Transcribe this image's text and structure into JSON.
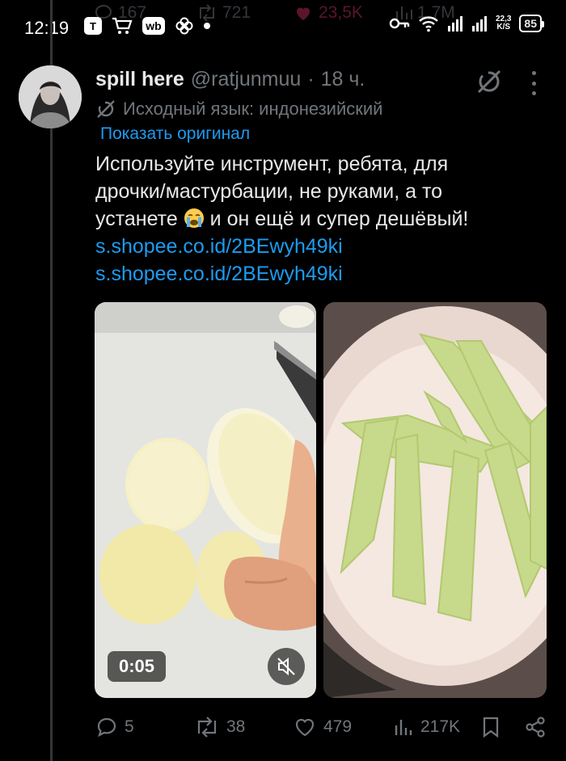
{
  "status_bar": {
    "time": "12:19",
    "net_speed_value": "22,3",
    "net_speed_unit": "K/S",
    "battery": "85",
    "behind": {
      "replies": "167",
      "retweets": "721",
      "likes": "23,5K",
      "views": "1,7M"
    }
  },
  "tweet": {
    "author_name": "spill here",
    "handle": "@ratjunmuu",
    "separator": "·",
    "time_ago": "18 ч.",
    "translation_note": "Исходный язык: индонезийский",
    "show_original": "Показать оригинал",
    "text_lines": [
      "Используйте инструмент, ребята, для",
      "дрочки/мастурбации, не руками, а то",
      "устанете",
      "и он ещё и супер дешёвый!"
    ],
    "emoji": "loudly-crying-face",
    "links": [
      "s.shopee.co.id/2BEwyh49ki",
      "s.shopee.co.id/2BEwyh49ki"
    ],
    "media": {
      "video_duration": "0:05",
      "muted": true
    },
    "stats": {
      "replies": "5",
      "retweets": "38",
      "likes": "479",
      "views": "217K"
    }
  },
  "icons": [
    "grok-icon",
    "more-icon",
    "translate-icon",
    "reply-icon",
    "retweet-icon",
    "like-icon",
    "views-icon",
    "bookmark-icon",
    "share-icon",
    "mute-icon"
  ],
  "colors": {
    "background": "#000000",
    "text": "#e7e9ea",
    "secondary": "#71767b",
    "accent": "#1d9bf0"
  }
}
